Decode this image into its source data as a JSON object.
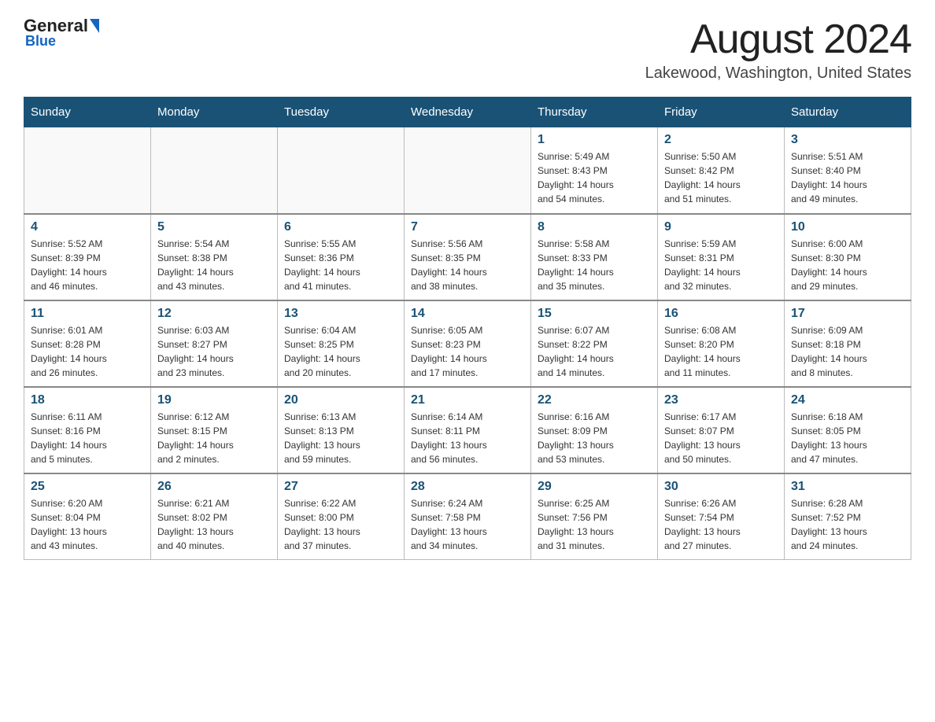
{
  "header": {
    "logo": {
      "general": "General",
      "blue": "Blue"
    },
    "title": "August 2024",
    "subtitle": "Lakewood, Washington, United States"
  },
  "days_of_week": [
    "Sunday",
    "Monday",
    "Tuesday",
    "Wednesday",
    "Thursday",
    "Friday",
    "Saturday"
  ],
  "weeks": [
    [
      {
        "day": "",
        "info": ""
      },
      {
        "day": "",
        "info": ""
      },
      {
        "day": "",
        "info": ""
      },
      {
        "day": "",
        "info": ""
      },
      {
        "day": "1",
        "info": "Sunrise: 5:49 AM\nSunset: 8:43 PM\nDaylight: 14 hours\nand 54 minutes."
      },
      {
        "day": "2",
        "info": "Sunrise: 5:50 AM\nSunset: 8:42 PM\nDaylight: 14 hours\nand 51 minutes."
      },
      {
        "day": "3",
        "info": "Sunrise: 5:51 AM\nSunset: 8:40 PM\nDaylight: 14 hours\nand 49 minutes."
      }
    ],
    [
      {
        "day": "4",
        "info": "Sunrise: 5:52 AM\nSunset: 8:39 PM\nDaylight: 14 hours\nand 46 minutes."
      },
      {
        "day": "5",
        "info": "Sunrise: 5:54 AM\nSunset: 8:38 PM\nDaylight: 14 hours\nand 43 minutes."
      },
      {
        "day": "6",
        "info": "Sunrise: 5:55 AM\nSunset: 8:36 PM\nDaylight: 14 hours\nand 41 minutes."
      },
      {
        "day": "7",
        "info": "Sunrise: 5:56 AM\nSunset: 8:35 PM\nDaylight: 14 hours\nand 38 minutes."
      },
      {
        "day": "8",
        "info": "Sunrise: 5:58 AM\nSunset: 8:33 PM\nDaylight: 14 hours\nand 35 minutes."
      },
      {
        "day": "9",
        "info": "Sunrise: 5:59 AM\nSunset: 8:31 PM\nDaylight: 14 hours\nand 32 minutes."
      },
      {
        "day": "10",
        "info": "Sunrise: 6:00 AM\nSunset: 8:30 PM\nDaylight: 14 hours\nand 29 minutes."
      }
    ],
    [
      {
        "day": "11",
        "info": "Sunrise: 6:01 AM\nSunset: 8:28 PM\nDaylight: 14 hours\nand 26 minutes."
      },
      {
        "day": "12",
        "info": "Sunrise: 6:03 AM\nSunset: 8:27 PM\nDaylight: 14 hours\nand 23 minutes."
      },
      {
        "day": "13",
        "info": "Sunrise: 6:04 AM\nSunset: 8:25 PM\nDaylight: 14 hours\nand 20 minutes."
      },
      {
        "day": "14",
        "info": "Sunrise: 6:05 AM\nSunset: 8:23 PM\nDaylight: 14 hours\nand 17 minutes."
      },
      {
        "day": "15",
        "info": "Sunrise: 6:07 AM\nSunset: 8:22 PM\nDaylight: 14 hours\nand 14 minutes."
      },
      {
        "day": "16",
        "info": "Sunrise: 6:08 AM\nSunset: 8:20 PM\nDaylight: 14 hours\nand 11 minutes."
      },
      {
        "day": "17",
        "info": "Sunrise: 6:09 AM\nSunset: 8:18 PM\nDaylight: 14 hours\nand 8 minutes."
      }
    ],
    [
      {
        "day": "18",
        "info": "Sunrise: 6:11 AM\nSunset: 8:16 PM\nDaylight: 14 hours\nand 5 minutes."
      },
      {
        "day": "19",
        "info": "Sunrise: 6:12 AM\nSunset: 8:15 PM\nDaylight: 14 hours\nand 2 minutes."
      },
      {
        "day": "20",
        "info": "Sunrise: 6:13 AM\nSunset: 8:13 PM\nDaylight: 13 hours\nand 59 minutes."
      },
      {
        "day": "21",
        "info": "Sunrise: 6:14 AM\nSunset: 8:11 PM\nDaylight: 13 hours\nand 56 minutes."
      },
      {
        "day": "22",
        "info": "Sunrise: 6:16 AM\nSunset: 8:09 PM\nDaylight: 13 hours\nand 53 minutes."
      },
      {
        "day": "23",
        "info": "Sunrise: 6:17 AM\nSunset: 8:07 PM\nDaylight: 13 hours\nand 50 minutes."
      },
      {
        "day": "24",
        "info": "Sunrise: 6:18 AM\nSunset: 8:05 PM\nDaylight: 13 hours\nand 47 minutes."
      }
    ],
    [
      {
        "day": "25",
        "info": "Sunrise: 6:20 AM\nSunset: 8:04 PM\nDaylight: 13 hours\nand 43 minutes."
      },
      {
        "day": "26",
        "info": "Sunrise: 6:21 AM\nSunset: 8:02 PM\nDaylight: 13 hours\nand 40 minutes."
      },
      {
        "day": "27",
        "info": "Sunrise: 6:22 AM\nSunset: 8:00 PM\nDaylight: 13 hours\nand 37 minutes."
      },
      {
        "day": "28",
        "info": "Sunrise: 6:24 AM\nSunset: 7:58 PM\nDaylight: 13 hours\nand 34 minutes."
      },
      {
        "day": "29",
        "info": "Sunrise: 6:25 AM\nSunset: 7:56 PM\nDaylight: 13 hours\nand 31 minutes."
      },
      {
        "day": "30",
        "info": "Sunrise: 6:26 AM\nSunset: 7:54 PM\nDaylight: 13 hours\nand 27 minutes."
      },
      {
        "day": "31",
        "info": "Sunrise: 6:28 AM\nSunset: 7:52 PM\nDaylight: 13 hours\nand 24 minutes."
      }
    ]
  ]
}
